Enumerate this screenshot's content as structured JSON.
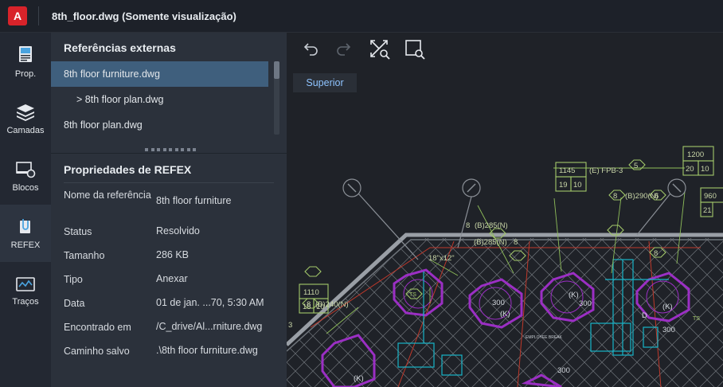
{
  "app": {
    "logo_letter": "A",
    "title": "8th_floor.dwg (Somente visualização)"
  },
  "rail": {
    "items": [
      {
        "label": "Prop.",
        "icon": "properties-icon"
      },
      {
        "label": "Camadas",
        "icon": "layers-icon"
      },
      {
        "label": "Blocos",
        "icon": "blocks-icon"
      },
      {
        "label": "REFEX",
        "icon": "xref-icon",
        "active": true
      },
      {
        "label": "Traços",
        "icon": "traces-icon"
      }
    ]
  },
  "xrefs": {
    "heading": "Referências externas",
    "items": [
      {
        "label": "8th floor furniture.dwg",
        "selected": true
      },
      {
        "label": "> 8th floor plan.dwg",
        "selected": false
      },
      {
        "label": "8th floor plan.dwg",
        "selected": false
      }
    ]
  },
  "props": {
    "heading": "Propriedades de REFEX",
    "rows": [
      {
        "key": "Nome da referência",
        "value": "8th floor furniture"
      },
      {
        "key": "Status",
        "value": "Resolvido"
      },
      {
        "key": "Tamanho",
        "value": "286 KB"
      },
      {
        "key": "Tipo",
        "value": "Anexar"
      },
      {
        "key": "Data",
        "value": "01 de jan. ...70, 5:30 AM"
      },
      {
        "key": "Encontrado em",
        "value": "/C_drive/Al...rniture.dwg"
      },
      {
        "key": "Caminho salvo",
        "value": ".\\8th floor furniture.dwg"
      }
    ]
  },
  "canvas": {
    "toolbar": [
      {
        "name": "undo-icon",
        "enabled": true
      },
      {
        "name": "redo-icon",
        "enabled": false
      },
      {
        "name": "zoom-extents-icon",
        "enabled": true
      },
      {
        "name": "zoom-window-icon",
        "enabled": true
      }
    ],
    "view_label": "Superior",
    "drawing_labels": {
      "t1145": "1145",
      "tE": "(E) FPB-3",
      "t5": "5",
      "t19": "19",
      "t10a": "10",
      "t1200": "1200",
      "t20": "20",
      "t10b": "10",
      "t960": "960",
      "t21": "21",
      "t8a": "8",
      "tB290": "(B)290(N)",
      "t6": "6",
      "t8b": "8",
      "tB285a": "(B)285(N)",
      "tB285b": "(B)285(N)",
      "t8c": "8",
      "t8d": "8",
      "t18x12": "18\"x12\"",
      "t8e": "8",
      "tB240": "(B)240(N)",
      "t3": "3",
      "t1110": "1110",
      "t18a": "18",
      "t10c": "10",
      "t300a": "300",
      "tKa": "(K)",
      "tKb": "(K)",
      "t300b": "300",
      "t300c": "300",
      "tKc": "(K)",
      "t300d": "300",
      "tKd": "(K)",
      "tD": "D",
      "tBreak": "EMPLOYEE BREAK",
      "tTS1": "TS",
      "tTS2": "TS"
    }
  },
  "colors": {
    "accent_selected": "#3f5f7d",
    "view_label": "#8fc4ff",
    "logo": "#d8232a"
  }
}
